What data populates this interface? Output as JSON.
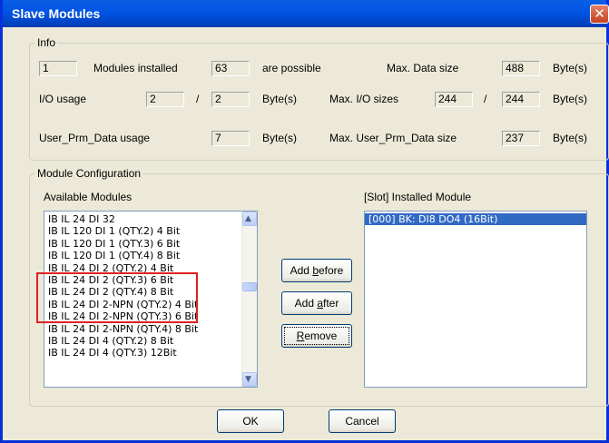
{
  "window": {
    "title": "Slave Modules",
    "close_glyph": "✕"
  },
  "info": {
    "legend": "Info",
    "modules_installed_value": "1",
    "modules_installed_label": "Modules installed",
    "possible_value": "63",
    "possible_label": "are possible",
    "max_data_size_label": "Max. Data size",
    "max_data_size_value": "488",
    "max_data_size_unit": "Byte(s)",
    "io_usage_label": "I/O usage",
    "io_usage_value1": "2",
    "io_usage_sep": "/",
    "io_usage_value2": "2",
    "io_usage_unit": "Byte(s)",
    "max_io_sizes_label": "Max. I/O sizes",
    "max_io_sizes_value1": "244",
    "max_io_sizes_sep": "/",
    "max_io_sizes_value2": "244",
    "max_io_sizes_unit": "Byte(s)",
    "user_prm_usage_label": "User_Prm_Data usage",
    "user_prm_usage_value": "7",
    "user_prm_usage_unit": "Byte(s)",
    "max_user_prm_label": "Max. User_Prm_Data size",
    "max_user_prm_value": "237",
    "max_user_prm_unit": "Byte(s)"
  },
  "module_config": {
    "legend": "Module Configuration",
    "available_label": "Available Modules",
    "installed_label": "[Slot] Installed Module",
    "available_modules": [
      "IB IL 24 DI 32",
      "IB IL 120 DI 1 (QTY.2) 4 Bit",
      "IB IL 120 DI 1 (QTY.3) 6 Bit",
      "IB IL 120 DI 1 (QTY.4) 8 Bit",
      "IB IL 24 DI 2 (QTY.2) 4 Bit",
      "IB IL 24 DI 2 (QTY.3) 6 Bit",
      "IB IL 24 DI 2 (QTY.4) 8 Bit",
      "IB IL 24 DI 2-NPN (QTY.2) 4 Bit",
      "IB IL 24 DI 2-NPN (QTY.3) 6 Bit",
      "IB IL 24 DI 2-NPN (QTY.4) 8 Bit",
      "IB IL 24 DI 4 (QTY.2) 8 Bit",
      "IB IL 24 DI 4 (QTY.3) 12Bit"
    ],
    "installed_modules": [
      "[000] BK: DI8 DO4 (16Bit)"
    ],
    "add_before": {
      "pre": "Add ",
      "key": "b",
      "post": "efore"
    },
    "add_after": {
      "pre": "Add ",
      "key": "a",
      "post": "fter"
    },
    "remove": {
      "pre": "",
      "key": "R",
      "post": "emove"
    }
  },
  "footer": {
    "ok_label": "OK",
    "cancel_label": "Cancel"
  },
  "colors": {
    "title_bar": "#0054e3",
    "selection": "#316ac5",
    "highlight_box": "#e02020"
  },
  "icons": {
    "scroll_up": "scroll-up-arrow-icon",
    "scroll_down": "scroll-down-arrow-icon",
    "close": "close-icon"
  }
}
